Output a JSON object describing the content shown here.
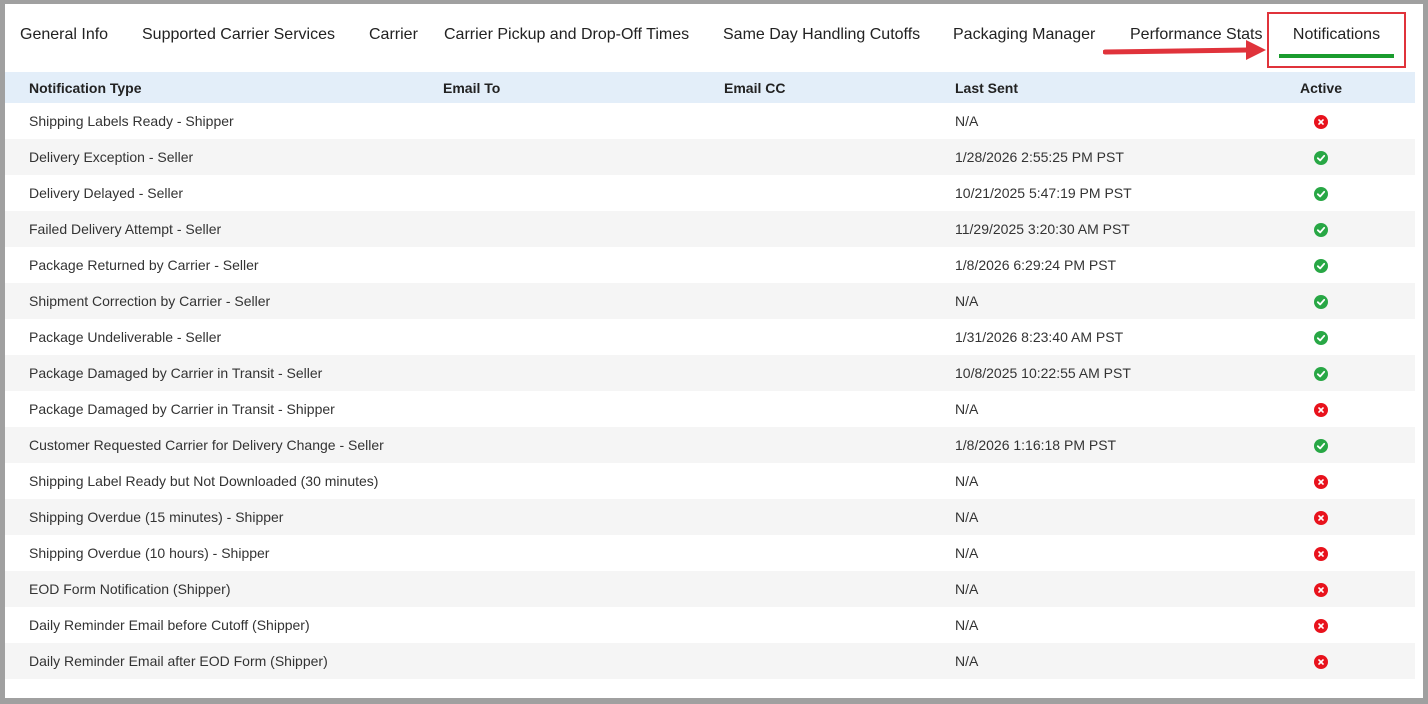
{
  "tabs": [
    {
      "label": "General Info"
    },
    {
      "label": "Supported Carrier Services"
    },
    {
      "label": "Carrier"
    },
    {
      "label": "Carrier Pickup and Drop-Off Times"
    },
    {
      "label": "Same Day Handling Cutoffs"
    },
    {
      "label": "Packaging Manager"
    },
    {
      "label": "Performance Stats"
    },
    {
      "label": "Notifications"
    }
  ],
  "table": {
    "headers": {
      "type": "Notification Type",
      "email_to": "Email To",
      "email_cc": "Email CC",
      "last_sent": "Last Sent",
      "active": "Active"
    },
    "rows": [
      {
        "type": "Shipping Labels Ready - Shipper",
        "email_to": "",
        "email_cc": "",
        "last_sent": "N/A",
        "active": false
      },
      {
        "type": "Delivery Exception - Seller",
        "email_to": "",
        "email_cc": "",
        "last_sent": "1/28/2026 2:55:25 PM PST",
        "active": true
      },
      {
        "type": "Delivery Delayed - Seller",
        "email_to": "",
        "email_cc": "",
        "last_sent": "10/21/2025 5:47:19 PM PST",
        "active": true
      },
      {
        "type": "Failed Delivery Attempt - Seller",
        "email_to": "",
        "email_cc": "",
        "last_sent": "11/29/2025 3:20:30 AM PST",
        "active": true
      },
      {
        "type": "Package Returned by Carrier - Seller",
        "email_to": "",
        "email_cc": "",
        "last_sent": "1/8/2026 6:29:24 PM PST",
        "active": true
      },
      {
        "type": "Shipment Correction by Carrier - Seller",
        "email_to": "",
        "email_cc": "",
        "last_sent": "N/A",
        "active": true
      },
      {
        "type": "Package Undeliverable - Seller",
        "email_to": "",
        "email_cc": "",
        "last_sent": "1/31/2026 8:23:40 AM PST",
        "active": true
      },
      {
        "type": "Package Damaged by Carrier in Transit - Seller",
        "email_to": "",
        "email_cc": "",
        "last_sent": "10/8/2025 10:22:55 AM PST",
        "active": true
      },
      {
        "type": "Package Damaged by Carrier in Transit - Shipper",
        "email_to": "",
        "email_cc": "",
        "last_sent": "N/A",
        "active": false
      },
      {
        "type": "Customer Requested Carrier for Delivery Change - Seller",
        "email_to": "",
        "email_cc": "",
        "last_sent": "1/8/2026 1:16:18 PM PST",
        "active": true
      },
      {
        "type": "Shipping Label Ready but Not Downloaded (30 minutes)",
        "email_to": "",
        "email_cc": "",
        "last_sent": "N/A",
        "active": false
      },
      {
        "type": "Shipping Overdue (15 minutes) - Shipper",
        "email_to": "",
        "email_cc": "",
        "last_sent": "N/A",
        "active": false
      },
      {
        "type": "Shipping Overdue (10 hours) - Shipper",
        "email_to": "",
        "email_cc": "",
        "last_sent": "N/A",
        "active": false
      },
      {
        "type": "EOD Form Notification (Shipper)",
        "email_to": "",
        "email_cc": "",
        "last_sent": "N/A",
        "active": false
      },
      {
        "type": "Daily Reminder Email before Cutoff (Shipper)",
        "email_to": "",
        "email_cc": "",
        "last_sent": "N/A",
        "active": false
      },
      {
        "type": "Daily Reminder Email after EOD Form (Shipper)",
        "email_to": "",
        "email_cc": "",
        "last_sent": "N/A",
        "active": false
      }
    ]
  },
  "icons": {
    "active_true": "check-circle-icon",
    "active_false": "x-circle-icon"
  },
  "colors": {
    "active_tab_underline": "#1a9c2e",
    "highlight_box": "#e0333b",
    "ok": "#28a745",
    "no": "#e8121c",
    "header_bg": "#e3eef9"
  }
}
